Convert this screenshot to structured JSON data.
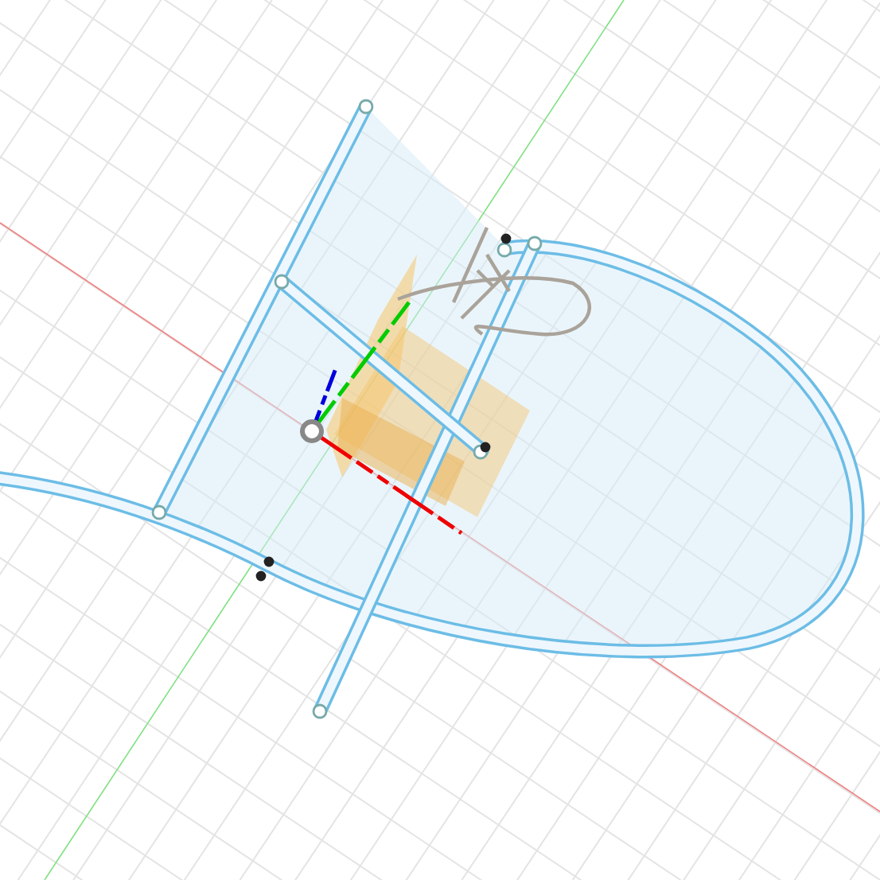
{
  "viewport": {
    "grid": true,
    "axes": true,
    "origin_selected": true
  }
}
